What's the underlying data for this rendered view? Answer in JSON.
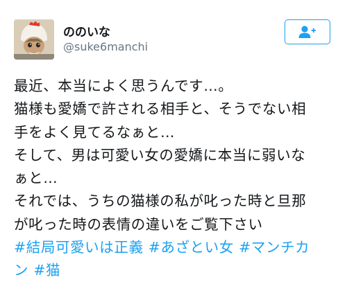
{
  "user": {
    "display_name": "ののいな",
    "handle": "@suke6manchi",
    "avatar_icon": "cat-in-chicken-hat-avatar"
  },
  "follow_button": {
    "icon": "follow-user-icon",
    "color": "#1da1f2"
  },
  "tweet": {
    "lines": [
      "最近、本当によく思うんです…。",
      "猫様も愛嬌で許される相手と、そうでない相",
      "手をよく見てるなぁと…",
      "そして、男は可愛い女の愛嬌に本当に弱いな",
      "ぁと…",
      "それでは、うちの猫様の私が叱った時と旦那",
      "が叱った時の表情の違いをご覧下さい"
    ],
    "hashtag_line1": [
      "#結局可愛いは正義",
      "#あざとい女",
      "#マンチカ"
    ],
    "hashtag_line2": [
      "ン",
      "#猫"
    ]
  },
  "colors": {
    "text": "#14171a",
    "secondary": "#657786",
    "accent": "#1da1f2"
  }
}
